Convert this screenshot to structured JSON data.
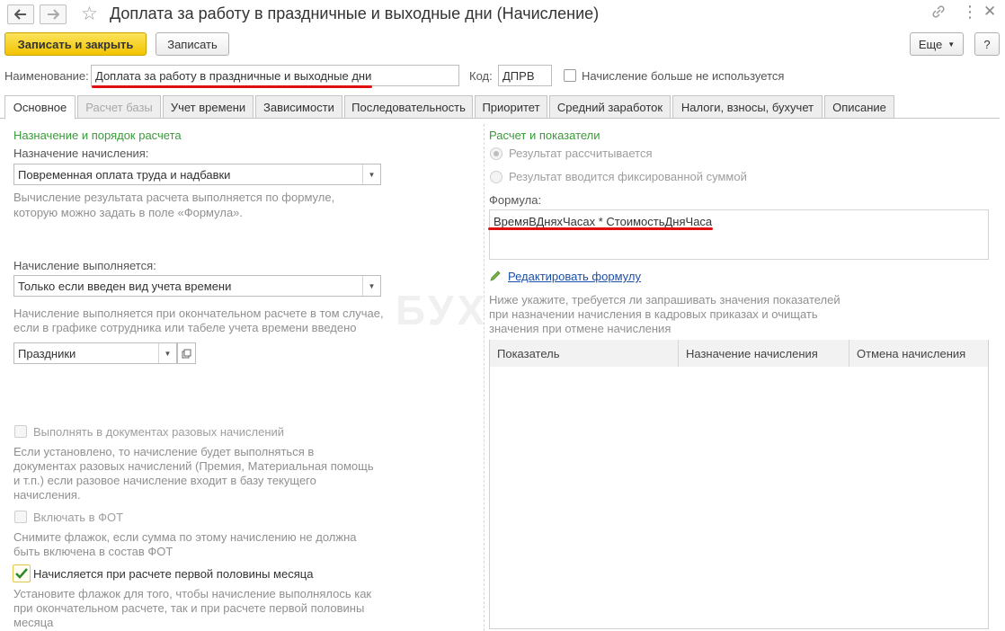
{
  "window": {
    "title": "Доплата за работу в праздничные и выходные дни (Начисление)",
    "back_icon": "arrow-left-icon",
    "forward_icon": "arrow-right-icon",
    "favorite_icon": "star-icon",
    "link_icon": "link-icon",
    "menu_icon": "more-vertical-icon",
    "close_icon": "close-icon"
  },
  "toolbar": {
    "save_close_label": "Записать и закрыть",
    "save_label": "Записать",
    "more_label": "Еще",
    "help_label": "?"
  },
  "header": {
    "name_label": "Наименование:",
    "name_value": "Доплата за работу в праздничные и выходные дни",
    "code_label": "Код:",
    "code_value": "ДПРВ",
    "unused_label": "Начисление больше не используется"
  },
  "tabs": [
    {
      "label": "Основное"
    },
    {
      "label": "Расчет базы"
    },
    {
      "label": "Учет времени"
    },
    {
      "label": "Зависимости"
    },
    {
      "label": "Последовательность"
    },
    {
      "label": "Приоритет"
    },
    {
      "label": "Средний заработок"
    },
    {
      "label": "Налоги, взносы, бухучет"
    },
    {
      "label": "Описание"
    }
  ],
  "left": {
    "section_title": "Назначение и порядок расчета",
    "purpose_label": "Назначение начисления:",
    "purpose_value": "Повременная оплата труда и надбавки",
    "purpose_hint_1": "Вычисление результата расчета выполняется по формуле,",
    "purpose_hint_2": "которую можно задать в поле «Формула».",
    "performed_label": "Начисление выполняется:",
    "performed_value": "Только если введен вид учета времени",
    "performed_hint_1": "Начисление выполняется при окончательном расчете в том случае,",
    "performed_hint_2": "если в графике сотрудника или табеле учета времени введено",
    "time_type_value": "Праздники",
    "one_time_label": "Выполнять в документах разовых начислений",
    "one_time_hint_1": "Если установлено, то начисление будет выполняться в",
    "one_time_hint_2": "документах разовых начислений (Премия, Материальная помощь",
    "one_time_hint_3": "и т.п.) если разовое начисление входит в базу текущего",
    "one_time_hint_4": "начисления.",
    "fot_label": "Включать в ФОТ",
    "fot_hint_1": "Снимите флажок, если сумма по этому начислению не должна",
    "fot_hint_2": "быть включена в состав ФОТ",
    "first_half_label": "Начисляется при расчете первой половины месяца",
    "first_half_hint_1": "Установите флажок для того, чтобы начисление выполнялось как",
    "first_half_hint_2": "при окончательном расчете, так и при расчете первой половины",
    "first_half_hint_3": "месяца"
  },
  "right": {
    "section_title": "Расчет и показатели",
    "radio_calculated": "Результат рассчитывается",
    "radio_fixed": "Результат вводится фиксированной суммой",
    "formula_label": "Формула:",
    "formula_value": "ВремяВДняхЧасах * СтоимостьДняЧаса",
    "edit_formula_link": "Редактировать формулу",
    "indicators_hint_1": "Ниже укажите, требуется ли запрашивать значения показателей",
    "indicators_hint_2": "при назначении начисления в кадровых приказах и очищать",
    "indicators_hint_3": "значения при отмене начисления",
    "table_columns": [
      "Показатель",
      "Назначение начисления",
      "Отмена начисления"
    ]
  },
  "watermark": "БУХ",
  "colors": {
    "primary_button": "#f2c300",
    "section_header": "#3b9a3b",
    "link": "#1a4fa8",
    "annotation": "#e01010"
  }
}
